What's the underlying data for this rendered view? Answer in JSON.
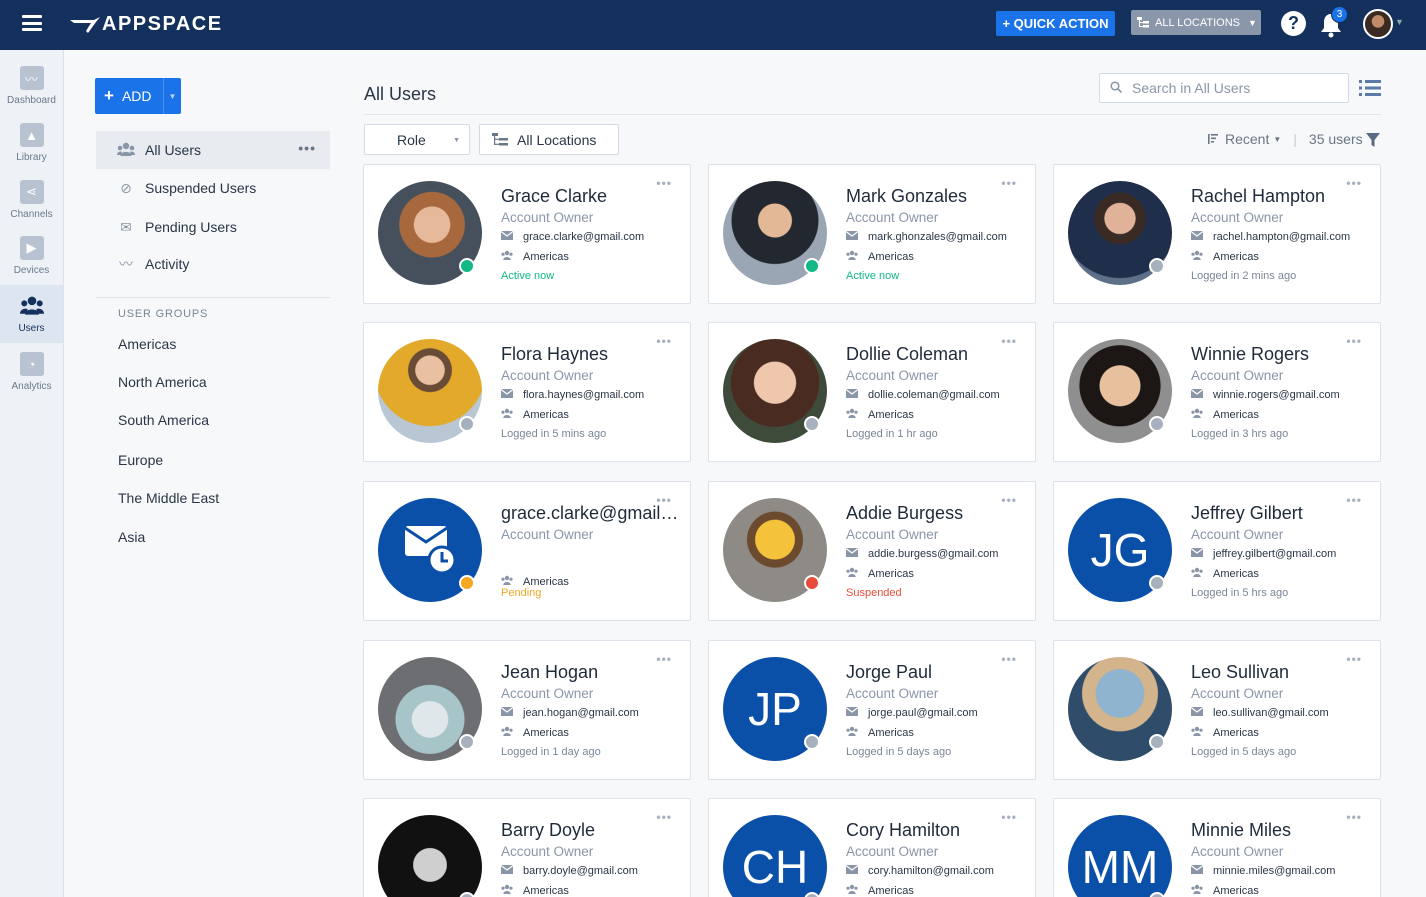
{
  "app": {
    "name": "APPSPACE"
  },
  "topbar": {
    "quick_action_label": "+ QUICK ACTION",
    "locations_label": "ALL LOCATIONS",
    "help_label": "?",
    "notification_count": "3"
  },
  "rail": {
    "items": [
      {
        "label": "Dashboard"
      },
      {
        "label": "Library"
      },
      {
        "label": "Channels"
      },
      {
        "label": "Devices"
      },
      {
        "label": "Users"
      },
      {
        "label": "Analytics"
      }
    ]
  },
  "sidebar": {
    "add_label": "ADD",
    "items": [
      {
        "label": "All Users",
        "more": "•••"
      },
      {
        "label": "Suspended Users"
      },
      {
        "label": "Pending Users"
      },
      {
        "label": "Activity"
      }
    ],
    "groups_title": "USER GROUPS",
    "groups": [
      "Americas",
      "North America",
      "South America",
      "Europe",
      "The Middle East",
      "Asia"
    ]
  },
  "main": {
    "title": "All Users",
    "search_placeholder": "Search in All Users",
    "role_filter": "Role",
    "location_filter": "All Locations",
    "sort_label": "Recent",
    "count_label": "35 users"
  },
  "colors": {
    "active": "#12b886",
    "offline": "#a7b1bd",
    "pending": "#f5a623",
    "suspended": "#e74c3c",
    "brand_blue": "#0a4fa8"
  },
  "users": [
    {
      "name": "Grace Clarke",
      "role": "Account Owner",
      "email": "grace.clarke@gmail.com",
      "group": "Americas",
      "state": "Active now",
      "state_color": "#12b886",
      "dot_color": "#12b886",
      "initials": ""
    },
    {
      "name": "Mark Gonzales",
      "role": "Account Owner",
      "email": "mark.ghonzales@gmail.com",
      "group": "Americas",
      "state": "Active now",
      "state_color": "#12b886",
      "dot_color": "#12b886",
      "initials": ""
    },
    {
      "name": "Rachel Hampton",
      "role": "Account Owner",
      "email": "rachel.hampton@gmail.com",
      "group": "Americas",
      "state": "Logged in 2 mins ago",
      "state_color": "#7a8696",
      "dot_color": "#a7b1bd",
      "initials": ""
    },
    {
      "name": "Flora Haynes",
      "role": "Account Owner",
      "email": "flora.haynes@gmail.com",
      "group": "Americas",
      "state": "Logged in 5 mins ago",
      "state_color": "#7a8696",
      "dot_color": "#a7b1bd",
      "initials": ""
    },
    {
      "name": "Dollie Coleman",
      "role": "Account Owner",
      "email": "dollie.coleman@gmail.com",
      "group": "Americas",
      "state": "Logged in 1 hr ago",
      "state_color": "#7a8696",
      "dot_color": "#a7b1bd",
      "initials": ""
    },
    {
      "name": "Winnie Rogers",
      "role": "Account Owner",
      "email": "winnie.rogers@gmail.com",
      "group": "Americas",
      "state": "Logged in 3 hrs ago",
      "state_color": "#7a8696",
      "dot_color": "#a7b1bd",
      "initials": ""
    },
    {
      "name": "grace.clarke@gmail.com",
      "role": "Account Owner",
      "email": "",
      "group": "Americas",
      "state": "Pending",
      "state_color": "#f5a623",
      "dot_color": "#f5a623",
      "initials": ""
    },
    {
      "name": "Addie Burgess",
      "role": "Account Owner",
      "email": "addie.burgess@gmail.com",
      "group": "Americas",
      "state": "Suspended",
      "state_color": "#e74c3c",
      "dot_color": "#e74c3c",
      "initials": ""
    },
    {
      "name": "Jeffrey Gilbert",
      "role": "Account Owner",
      "email": "jeffrey.gilbert@gmail.com",
      "group": "Americas",
      "state": "Logged in 5 hrs ago",
      "state_color": "#7a8696",
      "dot_color": "#a7b1bd",
      "initials": "JG"
    },
    {
      "name": "Jean Hogan",
      "role": "Account Owner",
      "email": "jean.hogan@gmail.com",
      "group": "Americas",
      "state": "Logged in 1 day ago",
      "state_color": "#7a8696",
      "dot_color": "#a7b1bd",
      "initials": ""
    },
    {
      "name": "Jorge Paul",
      "role": "Account Owner",
      "email": "jorge.paul@gmail.com",
      "group": "Americas",
      "state": "Logged in 5 days ago",
      "state_color": "#7a8696",
      "dot_color": "#a7b1bd",
      "initials": "JP"
    },
    {
      "name": "Leo Sullivan",
      "role": "Account Owner",
      "email": "leo.sullivan@gmail.com",
      "group": "Americas",
      "state": "Logged in 5 days ago",
      "state_color": "#7a8696",
      "dot_color": "#a7b1bd",
      "initials": ""
    },
    {
      "name": "Barry Doyle",
      "role": "Account Owner",
      "email": "barry.doyle@gmail.com",
      "group": "Americas",
      "state": "",
      "state_color": "#7a8696",
      "dot_color": "#a7b1bd",
      "initials": ""
    },
    {
      "name": "Cory Hamilton",
      "role": "Account Owner",
      "email": "cory.hamilton@gmail.com",
      "group": "Americas",
      "state": "",
      "state_color": "#7a8696",
      "dot_color": "#a7b1bd",
      "initials": "CH"
    },
    {
      "name": "Minnie Miles",
      "role": "Account Owner",
      "email": "minnie.miles@gmail.com",
      "group": "Americas",
      "state": "",
      "state_color": "#7a8696",
      "dot_color": "#a7b1bd",
      "initials": "MM"
    }
  ]
}
